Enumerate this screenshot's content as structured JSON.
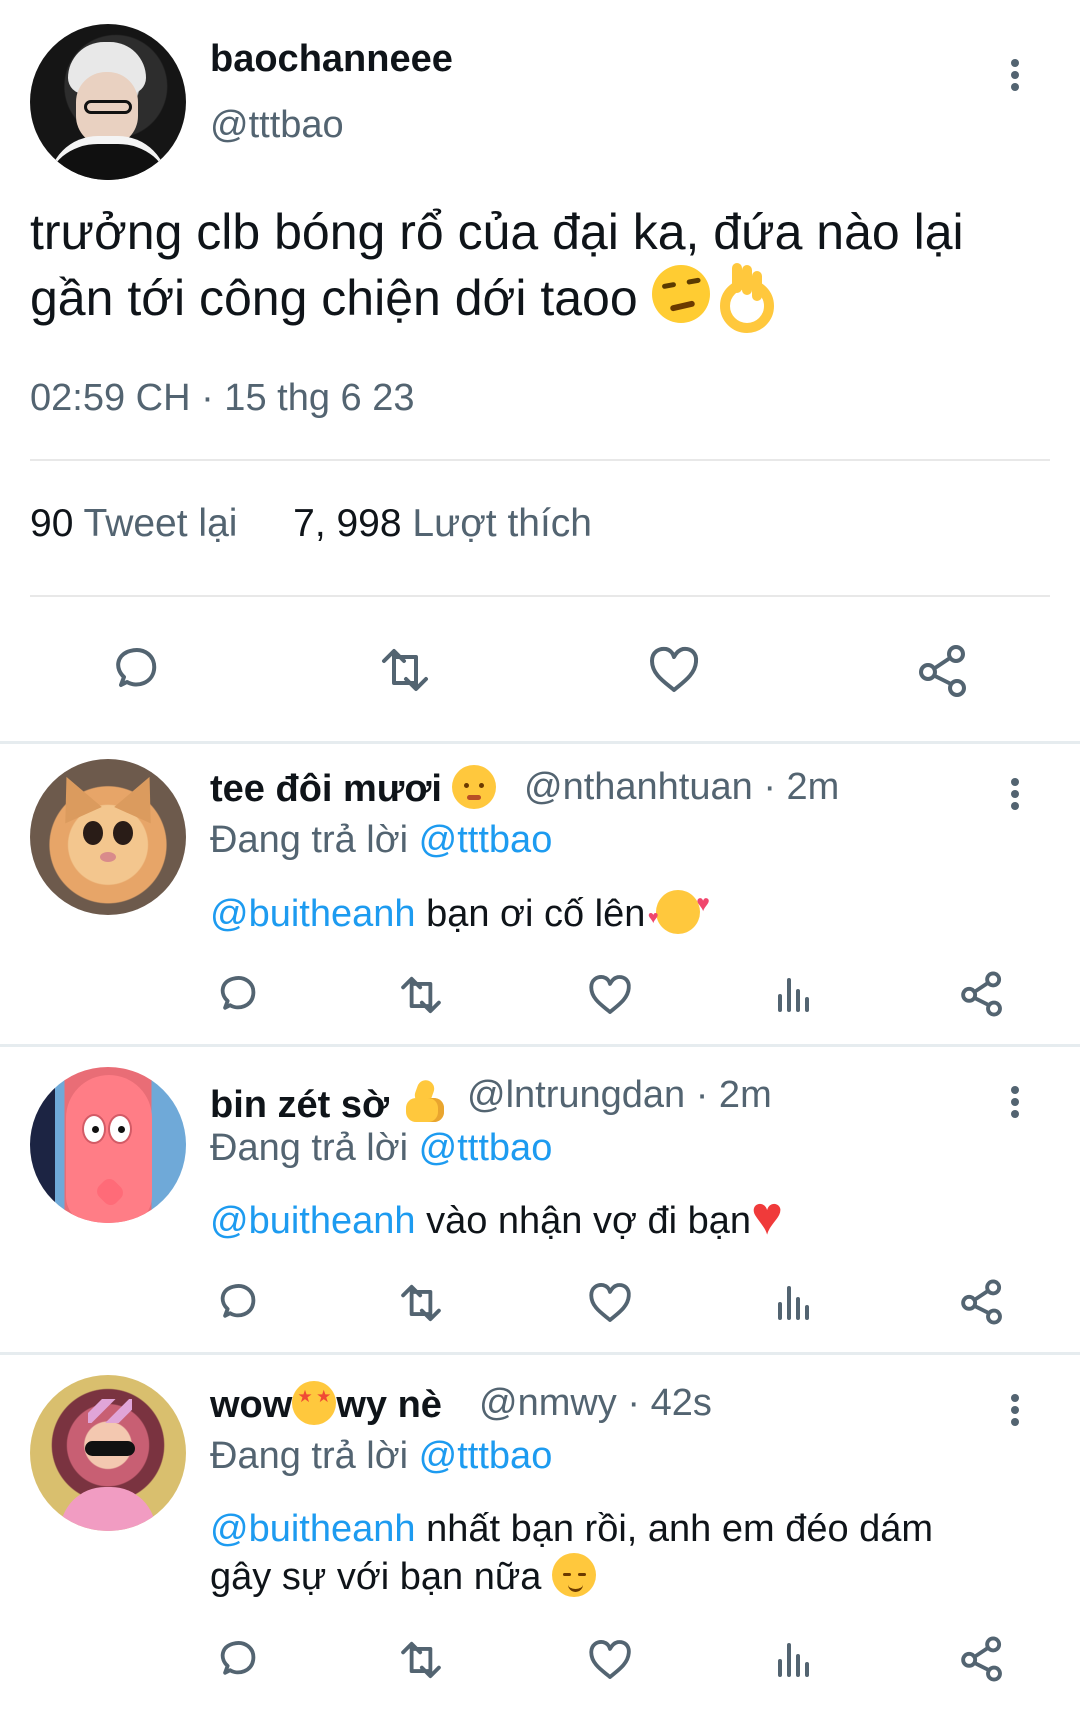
{
  "main_tweet": {
    "display_name": "baochanneee",
    "handle": "@tttbao",
    "text_line_1": "trưởng clb bóng rổ của đại ka, đứa nào lại",
    "text_line_2": "gần tới công chiện dới taoo",
    "emoji_names": [
      "smirking-face-emoji",
      "ok-hand-emoji"
    ],
    "timestamp": "02:59 CH · 15 thg 6 23",
    "retweet_count": "90",
    "retweet_label": "Tweet lại",
    "like_count": "7, 998",
    "like_label": "Lượt thích"
  },
  "replies": [
    {
      "display_name": "tee đôi mươi",
      "handle_time": "@nthanhtuan · 2m",
      "replying_prefix": "Đang trả lời",
      "replying_mention": "@tttbao",
      "mention": "@buitheanh",
      "text": " bạn ơi cố lên",
      "avatar_icon": "cat-avatar",
      "name_emoji": "baby-emoji",
      "text_emoji": "smiling-face-with-hearts-emoji"
    },
    {
      "display_name": "bin zét sờ",
      "handle_time": "@lntrungdan · 2m",
      "replying_prefix": "Đang trả lời",
      "replying_mention": "@tttbao",
      "mention": "@buitheanh",
      "text": " vào nhận vợ đi bạn",
      "avatar_icon": "patrick-avatar",
      "name_emoji": "thumbs-up-emoji",
      "text_emoji": "red-heart-emoji"
    },
    {
      "display_name_1": "wow",
      "display_name_2": "wy nè",
      "handle_time": "@nmwy · 42s",
      "replying_prefix": "Đang trả lời",
      "replying_mention": "@tttbao",
      "mention": "@buitheanh",
      "text_line_1": " nhất bạn rồi, anh em đéo dám",
      "text_line_2": "gây sự với bạn nữa",
      "avatar_icon": "girl-avatar",
      "name_emoji": "star-struck-emoji",
      "text_emoji": "smiling-face-emoji"
    }
  ],
  "colors": {
    "text": "#0f1419",
    "secondary": "#536471",
    "link": "#1d9bf0",
    "divider": "#e8e8e8"
  },
  "icons": [
    "more-icon",
    "reply-icon",
    "retweet-icon",
    "like-icon",
    "views-icon",
    "share-icon"
  ]
}
